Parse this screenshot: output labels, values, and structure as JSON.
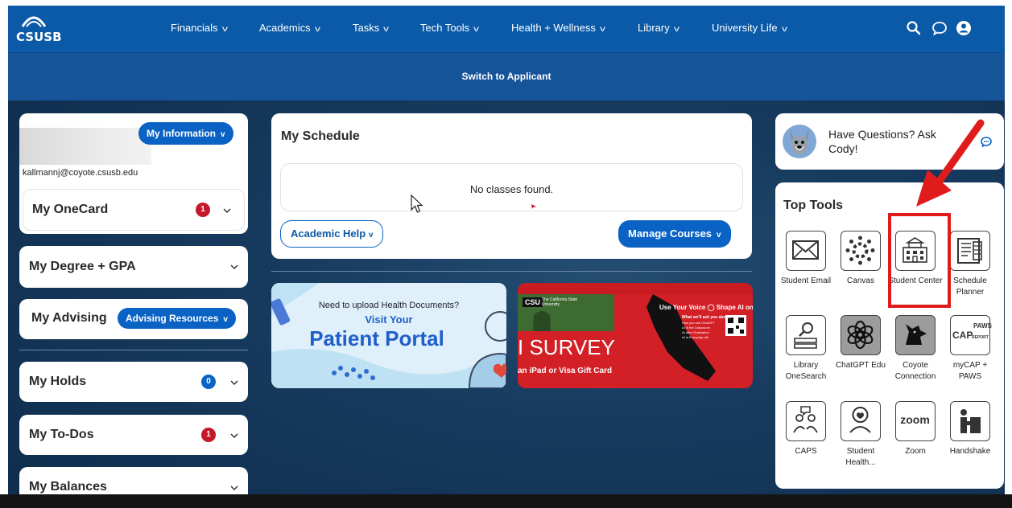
{
  "nav": {
    "logo_text": "CSUSB",
    "items": [
      {
        "label": "Financials"
      },
      {
        "label": "Academics"
      },
      {
        "label": "Tasks"
      },
      {
        "label": "Tech Tools"
      },
      {
        "label": "Health + Wellness"
      },
      {
        "label": "Library"
      },
      {
        "label": "University Life"
      }
    ],
    "applicant_label": "Switch to Applicant"
  },
  "profile": {
    "my_information_label": "My Information",
    "email": "kallmannj@coyote.csusb.edu"
  },
  "left_cards": {
    "onecard": {
      "title": "My OneCard",
      "badge": "1"
    },
    "degree": {
      "title": "My Degree + GPA"
    },
    "advising": {
      "title": "My Advising",
      "button": "Advising Resources"
    },
    "holds": {
      "title": "My Holds",
      "badge": "0"
    },
    "todos": {
      "title": "My To-Dos",
      "badge": "1"
    },
    "balances": {
      "title": "My Balances"
    }
  },
  "schedule": {
    "title": "My Schedule",
    "empty_message": "No classes found.",
    "academic_help_label": "Academic Help",
    "manage_courses_label": "Manage Courses"
  },
  "banners": {
    "health": {
      "line1": "Need to upload Health Documents?",
      "line2": "Visit Your",
      "line3": "Patient Portal"
    },
    "survey": {
      "csu": "CSU",
      "csu_sub": "The California State University",
      "tagline": "Use Your Voice",
      "tagline2": "Shape AI on C",
      "title": "I SURVEY",
      "subtitle": "an iPad or Visa Gift Card",
      "list_title": "What we'll ask you about:",
      "list": [
        "How you use ChatGPT",
        "AI in the Classroom",
        "AI after Graduation",
        "AI in Everyday Life"
      ]
    }
  },
  "cody": {
    "text": "Have Questions? Ask Cody!"
  },
  "top_tools": {
    "title": "Top Tools",
    "tools": [
      {
        "label": "Student Email",
        "icon": "envelope-icon"
      },
      {
        "label": "Canvas",
        "icon": "canvas-icon"
      },
      {
        "label": "Student Center",
        "icon": "building-icon"
      },
      {
        "label": "Schedule Planner",
        "icon": "planner-icon"
      },
      {
        "label": "Library OneSearch",
        "icon": "library-search-icon"
      },
      {
        "label": "ChatGPT Edu",
        "icon": "chatgpt-icon"
      },
      {
        "label": "Coyote Connection",
        "icon": "coyote-icon"
      },
      {
        "label": "myCAP + PAWS",
        "icon": "mycap-paws-icon"
      },
      {
        "label": "CAPS",
        "icon": "caps-icon"
      },
      {
        "label": "Student Health...",
        "icon": "student-health-icon"
      },
      {
        "label": "Zoom",
        "icon": "zoom-icon"
      },
      {
        "label": "Handshake",
        "icon": "handshake-icon"
      }
    ],
    "tool_texts": {
      "zoom": "zoom",
      "cap": "CAP",
      "paws": "PAWS",
      "report": "REPORT"
    }
  },
  "colors": {
    "nav": "#0a5aa8",
    "accent": "#0a63c4",
    "badge_red": "#c4182b",
    "highlight_red": "#e01b1b",
    "survey_red": "#d31f26"
  }
}
